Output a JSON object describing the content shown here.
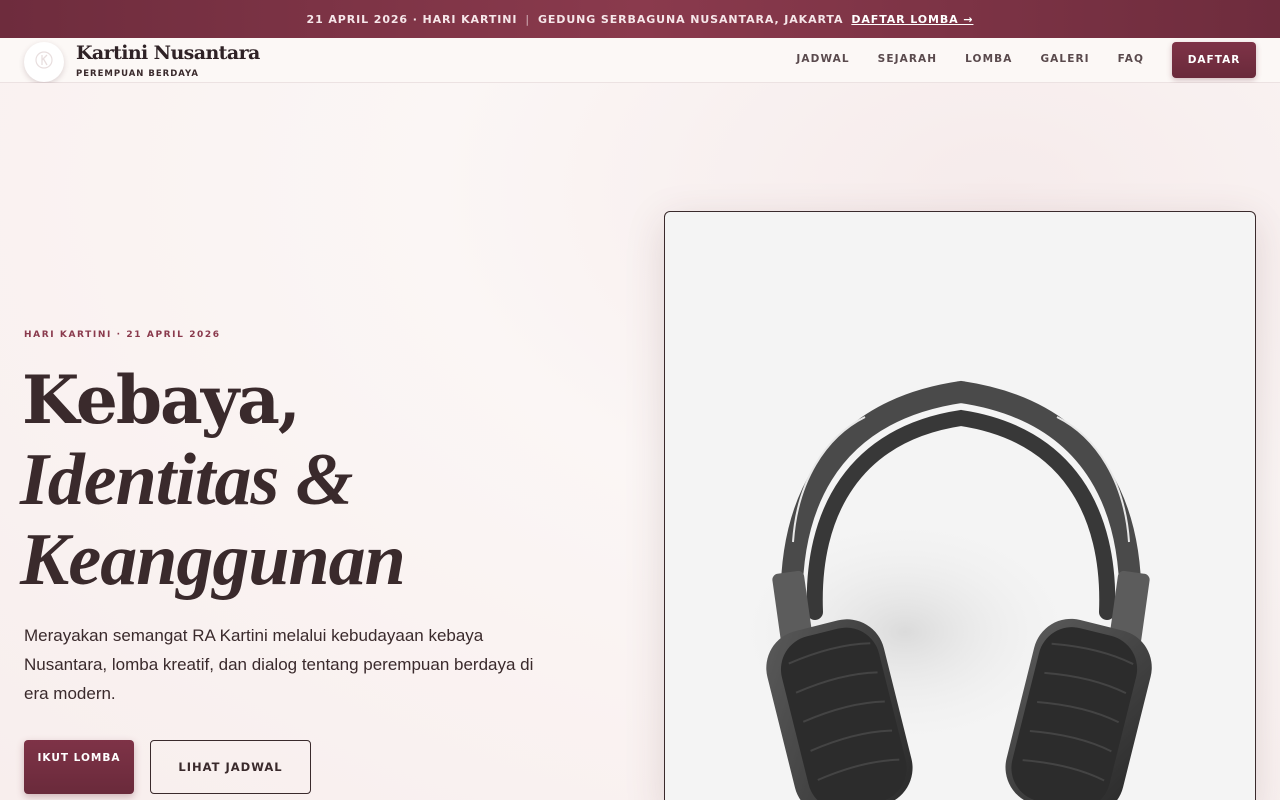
{
  "announcement": {
    "date": "21 APRIL 2026 · HARI KARTINI",
    "separator": "|",
    "venue": "GEDUNG SERBAGUNA NUSANTARA, JAKARTA",
    "link": "DAFTAR LOMBA →"
  },
  "brand": {
    "title": "Kartini Nusantara",
    "subtitle": "PEREMPUAN BERDAYA",
    "logo_icon": "k-monogram-icon"
  },
  "nav": {
    "items": [
      {
        "label": "JADWAL"
      },
      {
        "label": "SEJARAH"
      },
      {
        "label": "LOMBA"
      },
      {
        "label": "GALERI"
      },
      {
        "label": "FAQ"
      }
    ],
    "cta": "DAFTAR"
  },
  "hero": {
    "eyebrow": "HARI KARTINI · 21 APRIL 2026",
    "title_line1": "Kebaya,",
    "title_line2": "Identitas &",
    "title_line3": "Keanggunan",
    "description": "Merayakan semangat RA Kartini melalui kebudayaan kebaya Nusantara, lomba kreatif, dan dialog tentang perempuan berdaya di era modern.",
    "primary_cta": "IKUT LOMBA",
    "secondary_cta": "LIHAT JADWAL",
    "image_icon": "headphones-image"
  },
  "colors": {
    "accent": "#7a3044",
    "text": "#3a2a2c",
    "background": "#fbf6f5"
  }
}
